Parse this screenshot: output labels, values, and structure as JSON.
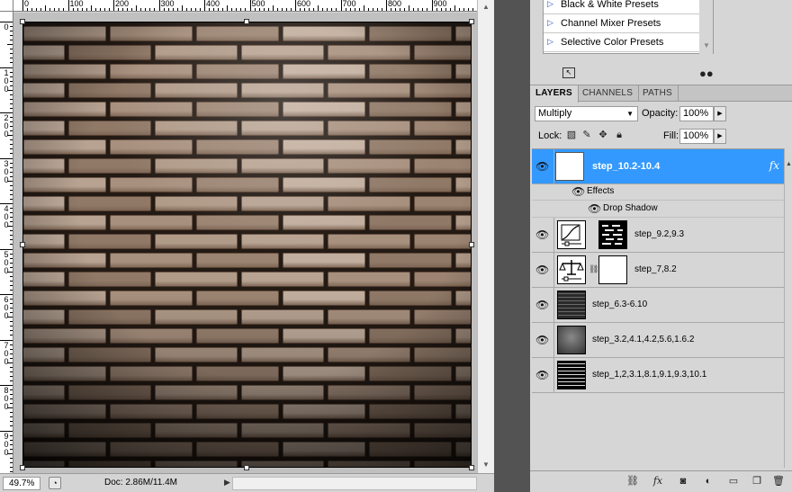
{
  "rulers": {
    "top_labels": [
      "0",
      "100",
      "200",
      "300",
      "400",
      "500",
      "600",
      "700",
      "800",
      "900"
    ],
    "left_labels": [
      "0",
      "100",
      "200",
      "300",
      "400",
      "500",
      "600",
      "700",
      "800",
      "900"
    ]
  },
  "status_bar": {
    "zoom": "49.7%",
    "doc_info": "Doc: 2.86M/11.4M"
  },
  "adjustments": {
    "presets": [
      {
        "label": "Black & White Presets"
      },
      {
        "label": "Channel Mixer Presets"
      },
      {
        "label": "Selective Color Presets"
      }
    ]
  },
  "layers_panel": {
    "tabs": [
      {
        "label": "LAYERS",
        "active": true
      },
      {
        "label": "CHANNELS",
        "active": false
      },
      {
        "label": "PATHS",
        "active": false
      }
    ],
    "blend_mode": "Multiply",
    "opacity_label": "Opacity:",
    "opacity_value": "100%",
    "lock_label": "Lock:",
    "fill_label": "Fill:",
    "fill_value": "100%",
    "layers": [
      {
        "name": "step_10.2-10.4",
        "selected": true,
        "fx": "fx",
        "effects_label": "Effects",
        "effects": [
          "Drop Shadow"
        ]
      },
      {
        "name": "step_9.2,9.3",
        "type": "curves-adjustment"
      },
      {
        "name": "step_7,8.2",
        "type": "color-balance-adjustment"
      },
      {
        "name": "step_6.3-6.10",
        "type": "pixel"
      },
      {
        "name": "step_3.2,4.1,4.2,5.6,1.6.2",
        "type": "pixel"
      },
      {
        "name": "step_1,2,3.1,8.1,9.1,9.3,10.1",
        "type": "pixel"
      }
    ]
  },
  "colors": {
    "selected_layer": "#3399ff",
    "panel_bg": "#d6d6d6",
    "workspace_bg": "#535353"
  }
}
